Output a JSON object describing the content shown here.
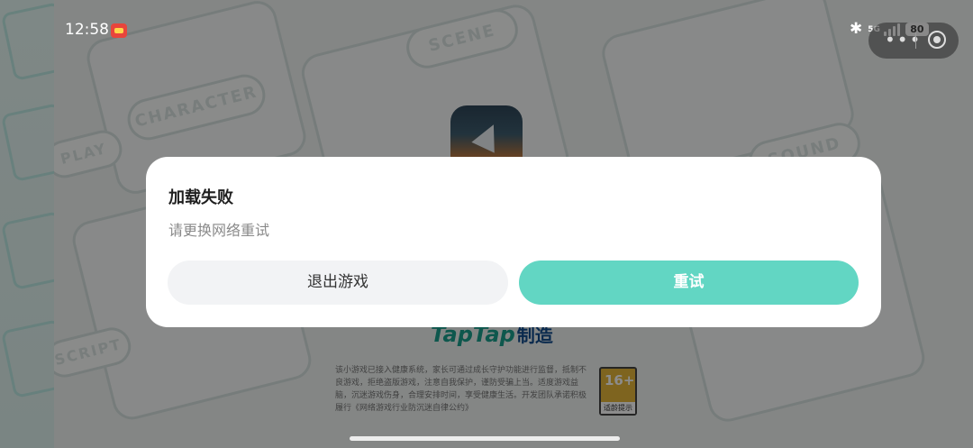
{
  "status_bar": {
    "time": "12:58",
    "network": "5G",
    "battery": "80"
  },
  "background": {
    "pill_words": [
      "SCENE",
      "CHARACTER",
      "SOUND",
      "PLAY",
      "SCRIPT"
    ],
    "brand": "TapTap",
    "brand_suffix": "制造",
    "disclaimer": "该小游戏已接入健康系统，家长可通过成长守护功能进行监督，抵制不良游戏，拒绝盗版游戏，注意自我保护，谨防受骗上当。适度游戏益脑，沉迷游戏伤身，合理安排时间，享受健康生活。开发团队承诺积极履行《网络游戏行业防沉迷自律公约》",
    "age_rating": "16+",
    "age_rating_label": "适龄提示"
  },
  "dialog": {
    "title": "加载失败",
    "message": "请更换网络重试",
    "exit_label": "退出游戏",
    "retry_label": "重试"
  },
  "colors": {
    "accent": "#62d6c3",
    "overlay": "rgba(0,0,0,0.45)"
  },
  "icons": [
    "bluetooth-icon",
    "signal-icon",
    "battery-icon",
    "more-icon",
    "close-target-icon",
    "plane-icon",
    "notification-icon"
  ]
}
